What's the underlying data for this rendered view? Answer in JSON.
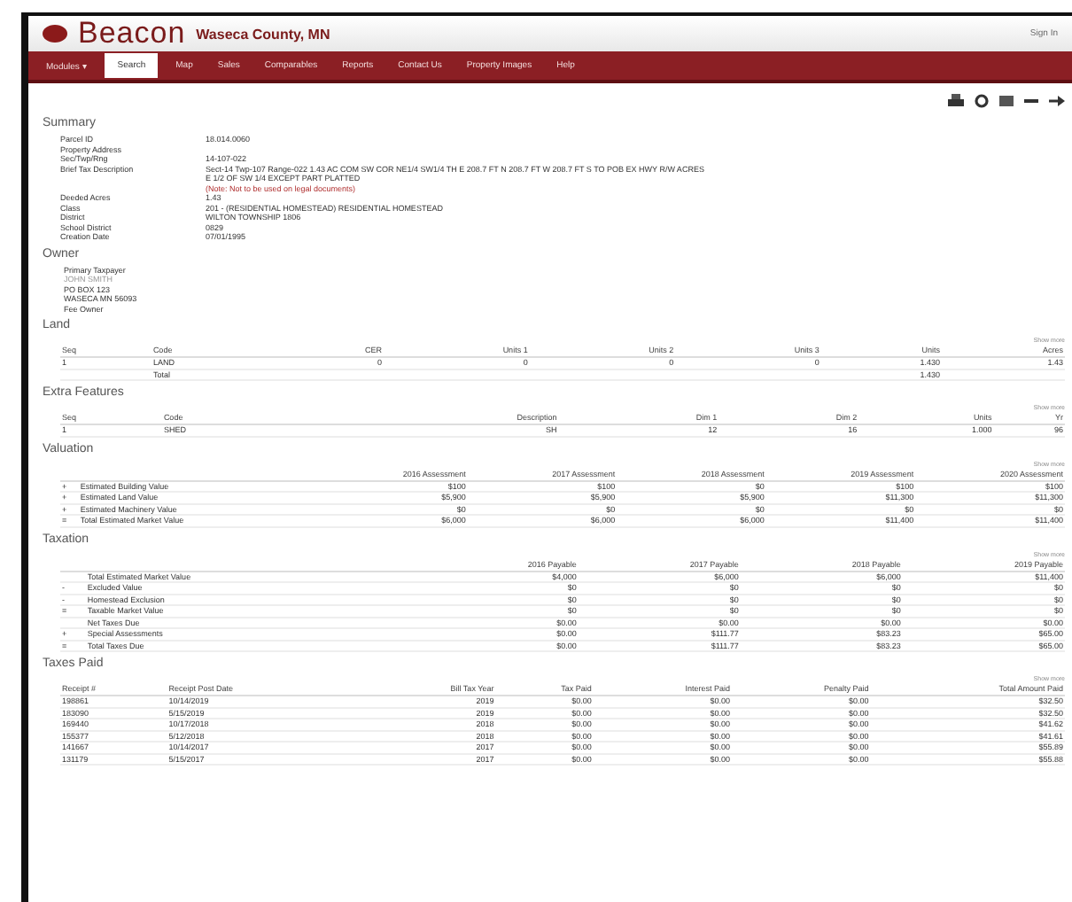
{
  "header": {
    "logo": "Beacon",
    "title": "Waseca County, MN",
    "user": "Sign In"
  },
  "nav": [
    {
      "label": "Modules ▾",
      "selected": false
    },
    {
      "label": "Search",
      "selected": true
    },
    {
      "label": "Map",
      "selected": false
    },
    {
      "label": "Sales",
      "selected": false
    },
    {
      "label": "Comparables",
      "selected": false
    },
    {
      "label": "Reports",
      "selected": false
    },
    {
      "label": "Contact Us",
      "selected": false
    },
    {
      "label": "Property Images",
      "selected": false
    },
    {
      "label": "Help",
      "selected": false
    }
  ],
  "sections": [
    {
      "kind": "kv",
      "title": "Summary",
      "rows": [
        {
          "label": "Parcel ID",
          "values": [
            "18.014.0060"
          ]
        },
        {
          "label": "Property Address",
          "values": []
        },
        {
          "label": "Sec/Twp/Rng",
          "values": [
            "14-107-022"
          ]
        },
        {
          "label": "Brief Tax Description",
          "values": [
            "Sect-14 Twp-107 Range-022 1.43 AC COM SW COR NE1/4 SW1/4 TH E 208.7 FT N 208.7 FT W 208.7 FT S TO POB EX HWY R/W ACRES",
            "E 1/2 OF SW 1/4 EXCEPT PART PLATTED",
            "(Note: Not to be used on legal documents)"
          ],
          "note_last": true
        },
        {
          "label": "Deeded Acres",
          "values": [
            "1.43"
          ]
        },
        {
          "label": "Class",
          "values": [
            "201 - (RESIDENTIAL HOMESTEAD) RESIDENTIAL HOMESTEAD"
          ]
        },
        {
          "label": "District",
          "values": [
            "WILTON TOWNSHIP 1806"
          ]
        },
        {
          "label": "School District",
          "values": [
            "0829"
          ]
        },
        {
          "label": "Creation Date",
          "values": [
            "07/01/1995"
          ]
        }
      ]
    },
    {
      "kind": "lines",
      "title": "Owner",
      "lines": [
        {
          "text": "Primary Taxpayer",
          "muted": false
        },
        {
          "text": "JOHN SMITH",
          "muted": true
        },
        {
          "text": "PO BOX 123",
          "muted": false
        },
        {
          "text": "WASECA MN 56093",
          "muted": false
        },
        {
          "text": "Fee Owner",
          "muted": false
        }
      ]
    },
    {
      "kind": "table",
      "title": "Land",
      "caption": "Show more",
      "columns": [
        "Seq",
        "Code",
        "CER",
        "Units 1",
        "Units 2",
        "Units 3",
        "Units",
        "Acres"
      ],
      "rows": [
        [
          "1",
          "LAND",
          "0",
          "0",
          "0",
          "0",
          "1.430",
          "1.43"
        ],
        [
          "",
          "Total",
          "",
          "",
          "",
          "",
          "1.430",
          ""
        ]
      ]
    },
    {
      "kind": "table",
      "title": "Extra Features",
      "caption": "Show more",
      "columns": [
        "Seq",
        "Code",
        "Description",
        "",
        "Dim 1",
        "Dim 2",
        "Units",
        "Yr"
      ],
      "rows": [
        [
          "1",
          "SHED",
          "SH",
          "",
          "12",
          "16",
          "1.000",
          "96"
        ]
      ]
    },
    {
      "kind": "table",
      "title": "Valuation",
      "caption": "Show more",
      "columns": [
        "",
        "",
        "2016 Assessment",
        "2017 Assessment",
        "2018 Assessment",
        "2019 Assessment",
        "2020 Assessment"
      ],
      "rows": [
        [
          "+",
          "Estimated Building Value",
          "$100",
          "$100",
          "$0",
          "$100",
          "$100"
        ],
        [
          "+",
          "Estimated Land Value",
          "$5,900",
          "$5,900",
          "$5,900",
          "$11,300",
          "$11,300"
        ],
        [
          "+",
          "Estimated Machinery Value",
          "$0",
          "$0",
          "$0",
          "$0",
          "$0"
        ],
        [
          "=",
          "Total Estimated Market Value",
          "$6,000",
          "$6,000",
          "$6,000",
          "$11,400",
          "$11,400"
        ]
      ]
    },
    {
      "kind": "table",
      "title": "Taxation",
      "caption": "Show more",
      "columns": [
        "",
        "",
        "2016 Payable",
        "2017 Payable",
        "2018 Payable",
        "2019 Payable"
      ],
      "rows": [
        [
          "",
          "Total Estimated Market Value",
          "$4,000",
          "$6,000",
          "$6,000",
          "$11,400"
        ],
        [
          "-",
          "Excluded Value",
          "$0",
          "$0",
          "$0",
          "$0"
        ],
        [
          "-",
          "Homestead Exclusion",
          "$0",
          "$0",
          "$0",
          "$0"
        ],
        [
          "=",
          "Taxable Market Value",
          "$0",
          "$0",
          "$0",
          "$0"
        ],
        [
          "",
          "Net Taxes Due",
          "$0.00",
          "$0.00",
          "$0.00",
          "$0.00"
        ],
        [
          "+",
          "Special Assessments",
          "$0.00",
          "$111.77",
          "$83.23",
          "$65.00"
        ],
        [
          "=",
          "Total Taxes Due",
          "$0.00",
          "$111.77",
          "$83.23",
          "$65.00"
        ]
      ]
    },
    {
      "kind": "table",
      "title": "Taxes Paid",
      "caption": "Show more",
      "columns": [
        "Receipt #",
        "Receipt Post Date",
        "Bill Tax Year",
        "Tax Paid",
        "Interest Paid",
        "Penalty Paid",
        "Total Amount Paid"
      ],
      "rows": [
        [
          "198861",
          "10/14/2019",
          "2019",
          "$0.00",
          "$0.00",
          "$0.00",
          "$32.50"
        ],
        [
          "183090",
          "5/15/2019",
          "2019",
          "$0.00",
          "$0.00",
          "$0.00",
          "$32.50"
        ],
        [
          "169440",
          "10/17/2018",
          "2018",
          "$0.00",
          "$0.00",
          "$0.00",
          "$41.62"
        ],
        [
          "155377",
          "5/12/2018",
          "2018",
          "$0.00",
          "$0.00",
          "$0.00",
          "$41.61"
        ],
        [
          "141667",
          "10/14/2017",
          "2017",
          "$0.00",
          "$0.00",
          "$0.00",
          "$55.89"
        ],
        [
          "131179",
          "5/15/2017",
          "2017",
          "$0.00",
          "$0.00",
          "$0.00",
          "$55.88"
        ]
      ]
    }
  ]
}
